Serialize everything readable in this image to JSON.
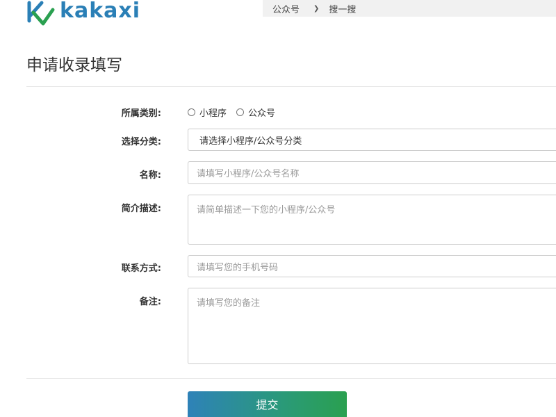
{
  "header": {
    "logo_text": "kakaxi",
    "search": {
      "type_value": "公众号",
      "label": "搜一搜"
    }
  },
  "page": {
    "title": "申请收录填写"
  },
  "form": {
    "category": {
      "label": "所属类别:",
      "options": [
        "小程序",
        "公众号"
      ]
    },
    "classification": {
      "label": "选择分类:",
      "value": "请选择小程序/公众号分类"
    },
    "name": {
      "label": "名称:",
      "placeholder": "请填写小程序/公众号名称"
    },
    "description": {
      "label": "简介描述:",
      "placeholder": "请简单描述一下您的小程序/公众号"
    },
    "contact": {
      "label": "联系方式:",
      "placeholder": "请填写您的手机号码"
    },
    "remarks": {
      "label": "备注:",
      "placeholder": "请填写您的备注"
    },
    "submit_label": "提交"
  },
  "colors": {
    "brand": "#2a7fb6",
    "brand_green": "#2aa050",
    "border": "#cccccc"
  },
  "icons": {
    "logo": "kakaxi-logo-icon",
    "dropdown": "chevron-down-icon",
    "radio": "radio-unchecked-icon"
  }
}
